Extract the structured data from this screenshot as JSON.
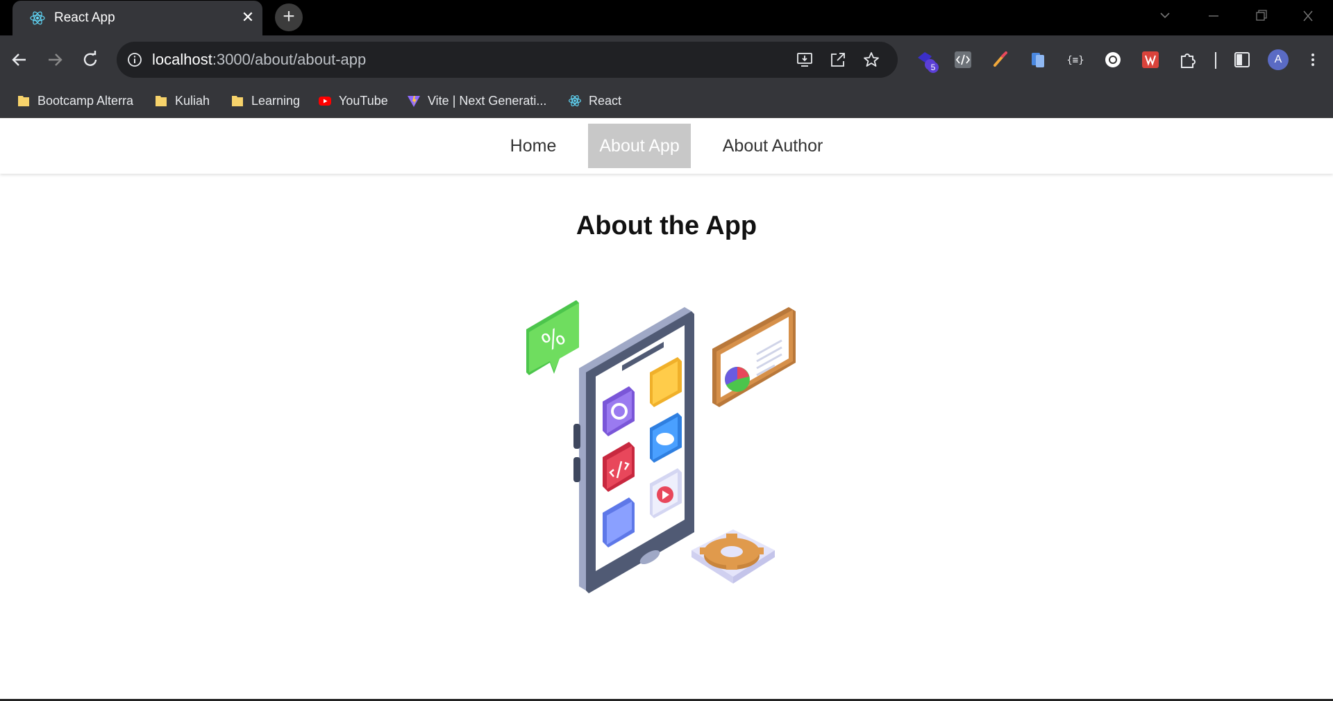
{
  "browser": {
    "tab": {
      "title": "React App",
      "favicon": "react-icon",
      "close": "✕"
    },
    "new_tab": "+",
    "address": {
      "host": "localhost",
      "rest": ":3000/about/about-app"
    },
    "bookmarks": [
      {
        "label": "Bootcamp Alterra",
        "icon": "folder-icon"
      },
      {
        "label": "Kuliah",
        "icon": "folder-icon"
      },
      {
        "label": "Learning",
        "icon": "folder-icon"
      },
      {
        "label": "YouTube",
        "icon": "youtube-icon"
      },
      {
        "label": "Vite | Next Generati...",
        "icon": "vite-icon"
      },
      {
        "label": "React",
        "icon": "react-icon"
      }
    ],
    "extension_badge": "5",
    "profile_initial": "A"
  },
  "nav": {
    "links": [
      {
        "label": "Home",
        "active": false
      },
      {
        "label": "About App",
        "active": true
      },
      {
        "label": "About Author",
        "active": false
      }
    ]
  },
  "main": {
    "title": "About the App",
    "illustration": "smartphone-apps-illustration",
    "badge_text": "%"
  },
  "colors": {
    "chrome_bg": "#35363a",
    "tabstrip_bg": "#000000",
    "active_nav_bg": "#c8c8c8",
    "text": "#333333"
  }
}
